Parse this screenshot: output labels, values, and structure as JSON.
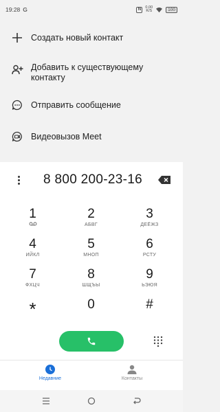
{
  "status_bar": {
    "time": "19:28",
    "g_icon": "G",
    "nfc": "N",
    "speed_top": "0,00",
    "speed_bottom": "K/S",
    "battery": "100"
  },
  "menu": {
    "items": [
      {
        "label": "Создать новый контакт",
        "icon": "plus-icon"
      },
      {
        "label": "Добавить к существующему контакту",
        "icon": "add-person-icon"
      },
      {
        "label": "Отправить сообщение",
        "icon": "message-icon"
      },
      {
        "label": "Видеовызов Meet",
        "icon": "meet-video-icon"
      }
    ]
  },
  "dialer": {
    "number": "8 800 200-23-16",
    "keys": [
      {
        "digit": "1",
        "letters": ""
      },
      {
        "digit": "2",
        "letters": "АБВГ"
      },
      {
        "digit": "3",
        "letters": "ДЕЁЖЗ"
      },
      {
        "digit": "4",
        "letters": "ИЙКЛ"
      },
      {
        "digit": "5",
        "letters": "МНОП"
      },
      {
        "digit": "6",
        "letters": "РСТУ"
      },
      {
        "digit": "7",
        "letters": "ФХЦЧ"
      },
      {
        "digit": "8",
        "letters": "ШЩЪЫ"
      },
      {
        "digit": "9",
        "letters": "ЬЭЮЯ"
      },
      {
        "digit": "*",
        "letters": ""
      },
      {
        "digit": "0",
        "letters": ""
      },
      {
        "digit": "#",
        "letters": ""
      }
    ],
    "call_color": "#27c068"
  },
  "tabs": {
    "recent": "Недавние",
    "contacts": "Контакты",
    "active_color": "#1a6fd8"
  }
}
